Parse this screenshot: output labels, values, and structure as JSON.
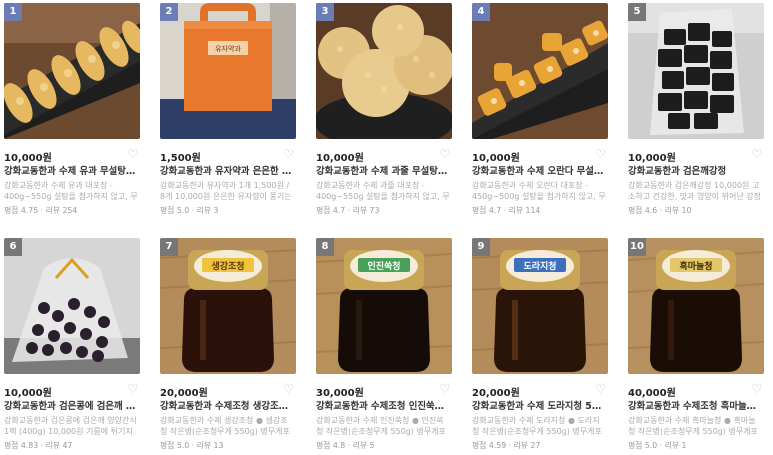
{
  "products": [
    {
      "rank": "1",
      "price": "10,000원",
      "title": "강화교동한과 수제 유과 무설탕 무방부제",
      "desc": "강화교동한과 수제 유과 대포장 - 400g~550g 설탕을 첨가하지 않고, 무우조청을 이용해",
      "meta": "평점 4.75 · 리뷰 254",
      "image_icon": "sugar-cookie-tray"
    },
    {
      "rank": "2",
      "price": "1,500원",
      "title": "강화교동한과 유자약과 은은한 유자가 풍기는",
      "desc": "강화교동한과 유자약과 1개 1,500원 / 8개 10,000원 은은한 유자향이 풍기는 강화교동한",
      "meta": "평점 5.0 · 리뷰 3",
      "image_icon": "orange-gift-box",
      "box_label": "유자약과"
    },
    {
      "rank": "3",
      "price": "10,000원",
      "title": "강화교동한과 수제 과줄 무설탕 무방부제",
      "desc": "강화교동한과 수제 과줄 대포장 - 400g~550g 설탕을 첨가하지 않고, 무우조청을 이용해",
      "meta": "평점 4.7 · 리뷰 73",
      "image_icon": "rice-puff-cakes"
    },
    {
      "rank": "4",
      "price": "10,000원",
      "title": "강화교동한과 수제 오란다 무설탕 무방부제",
      "desc": "강화교동한과 수제 오란다 대포장 - 450g~500g 설탕을 첨가하지 않고, 무우조청을 이용해",
      "meta": "평점 4.7 · 리뷰 114",
      "image_icon": "oranda-pieces"
    },
    {
      "rank": "5",
      "price": "10,000원",
      "title": "강화교동한과 검은깨강정",
      "desc": "강화교동한과 검은깨강정 10,000원 고소하고 건강한, 맛과 영양이 뛰어난 강정입니다. 바",
      "meta": "평점 4.6 · 리뷰 10",
      "image_icon": "black-sesame-bag"
    },
    {
      "rank": "6",
      "price": "10,000원",
      "title": "강화교동한과 검은콩에 검은깨 영양간식",
      "desc": "강화교동한과 검은콩에 검은깨 영양간식 1팩 (400g) 10,000원 기름에 튀기지 않고 고소",
      "meta": "평점 4.83 · 리뷰 47",
      "image_icon": "black-bean-bag"
    },
    {
      "rank": "7",
      "price": "20,000원",
      "title": "강화교동한과 수제조청 생강조청 작은병",
      "desc": "강화교동한과 수제 생강조청 ● 생강조청 작은병(순조청무게 550g) 병무게포함 870g ●",
      "meta": "평점 5.0 · 리뷰 13",
      "image_icon": "jar",
      "jar_label": "생강조청",
      "jar_label_color": "#f0c33d"
    },
    {
      "rank": "8",
      "price": "30,000원",
      "title": "강화교동한과 수제조청 인진쑥청 큰병",
      "desc": "강화교동한과 수제 인진쑥청 ● 인진쑥청 작은병(순조청무게 550g) 병무게포함 870g ●",
      "meta": "평점 4.8 · 리뷰 5",
      "image_icon": "jar",
      "jar_label": "인진쑥청",
      "jar_label_color": "#4aa05a"
    },
    {
      "rank": "9",
      "price": "20,000원",
      "title": "강화교동한과 수제 도라지청 550g 무설탕",
      "desc": "강화교동한과 수제 도라지청 ● 도라지청 작은병(순조청무게 550g) 병무게포함 870g ●",
      "meta": "평점 4.59 · 리뷰 27",
      "image_icon": "jar",
      "jar_label": "도라지청",
      "jar_label_color": "#3d6fbf"
    },
    {
      "rank": "10",
      "price": "40,000원",
      "title": "강화교동한과 수제조청 흑마늘청 큰병",
      "desc": "강화교동한과 수제 흑마늘청 ● 흑마늘청 작은병(순조청무게 550g) 병무게포함 870g ●",
      "meta": "평점 5.0 · 리뷰 1",
      "image_icon": "jar",
      "jar_label": "흑마늘청",
      "jar_label_color": "#e3c86a"
    }
  ],
  "colors": {
    "rank_badge": "#6b7cb6",
    "rank_badge_alt": "#777777",
    "price": "#222222",
    "desc": "#aaaaaa",
    "heart": "#bbbbbb"
  }
}
